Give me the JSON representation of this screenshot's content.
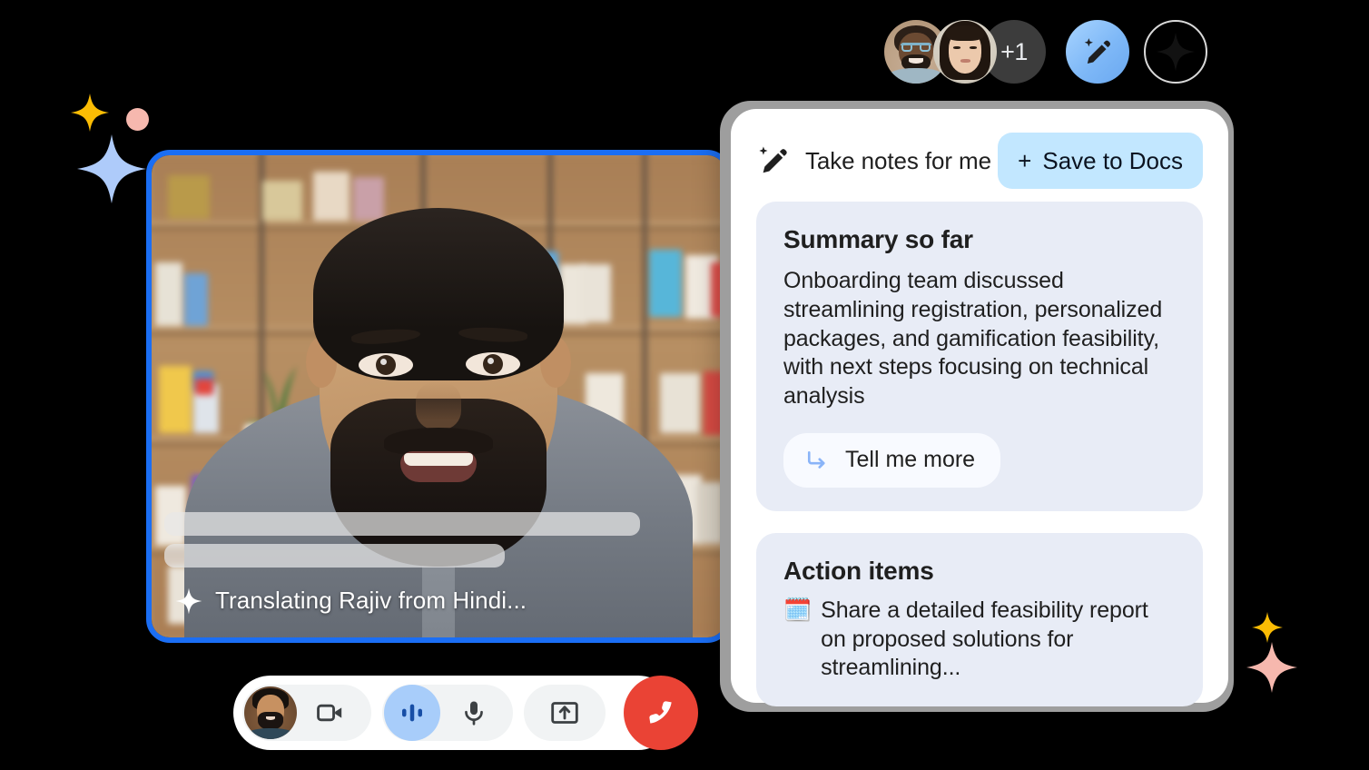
{
  "top_bar": {
    "participants": [
      {
        "name": "participant-avatar-1",
        "alt": "Smiling man with glasses"
      },
      {
        "name": "participant-avatar-2",
        "alt": "Smiling woman"
      }
    ],
    "overflow_count": "+1",
    "magic_pencil_icon": "magic-pencil-icon",
    "gemini_icon": "gemini-sparkle-icon"
  },
  "video": {
    "caption_text": "Translating Rajiv from Hindi...",
    "caption_sparkle_icon": "sparkle-icon",
    "border_color": "#1b6ef4",
    "placeholder_bars": 2
  },
  "controls": {
    "self_view_label": "self-view-avatar",
    "camera_label": "camera-icon",
    "audio_wave_label": "audio-wave-icon",
    "mic_label": "microphone-icon",
    "present_label": "present-screen-icon",
    "end_call_label": "end-call-icon",
    "end_call_color": "#ea4335",
    "active_color": "#a8cdfa"
  },
  "notes": {
    "header_title": "Take notes for me",
    "header_icon": "magic-pencil-icon",
    "save_button_label": "Save to Docs",
    "save_button_plus": "+",
    "save_button_color": "#c2e7ff",
    "cards": [
      {
        "title": "Summary so far",
        "body": "Onboarding team discussed streamlining registration, personalized packages, and gamification feasibility, with next steps focusing on technical analysis",
        "action_label": "Tell me more",
        "action_icon": "reply-arrow-icon"
      },
      {
        "title": "Action items",
        "item_emoji": "🗓️",
        "item_text": "Share a detailed feasibility report on proposed solutions for streamlining...",
        "item_emoji_name": "calendar-emoji"
      }
    ],
    "card_background": "#e8ecf6"
  },
  "decor": {
    "sparkle_yellow": "#fbbc04",
    "sparkle_blue": "#aecbfa",
    "sparkle_pink": "#f6b8ae",
    "dot_pink": "#f6b8ae"
  }
}
